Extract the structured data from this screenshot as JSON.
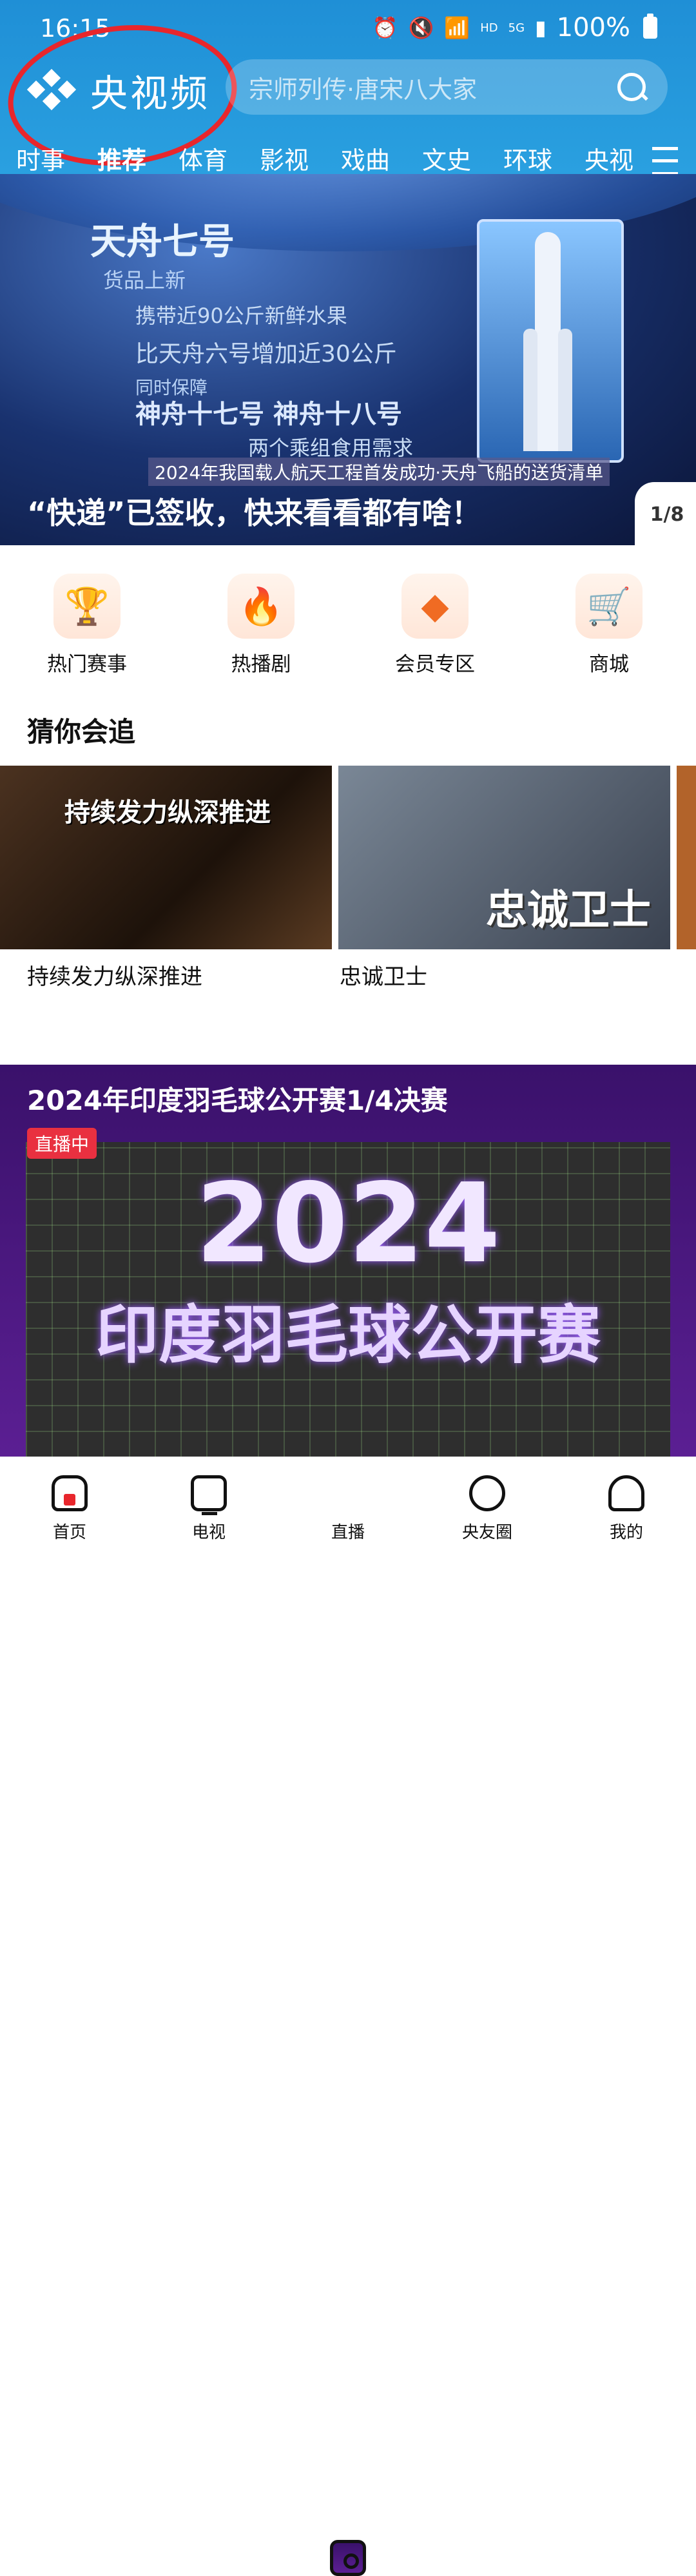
{
  "status_bar": {
    "time": "16:15",
    "battery": "100%",
    "net1": "HD",
    "net2": "5G"
  },
  "header": {
    "app_name": "央视频",
    "search_placeholder": "宗师列传·唐宋八大家"
  },
  "tabs": [
    "时事",
    "推荐",
    "体育",
    "影视",
    "戏曲",
    "文史",
    "环球",
    "央视"
  ],
  "hero": {
    "overlay_title": "天舟七号",
    "overlay_subtitle": "货品上新",
    "overlay_line1": "携带近90公斤新鲜水果",
    "overlay_line2": "比天舟六号增加近30公斤",
    "overlay_line3": "同时保障",
    "overlay_line4": "神舟十七号  神舟十八号",
    "overlay_line5": "两个乘组食用需求",
    "caption": "2024年我国载人航天工程首发成功·天舟飞船的送货清单",
    "title": "“快递”已签收，快来看看都有啥！",
    "page_indicator": "1/8"
  },
  "quick_links": [
    {
      "label": "热门赛事",
      "icon": "trophy-icon"
    },
    {
      "label": "热播剧",
      "icon": "hot-flame-icon"
    },
    {
      "label": "会员专区",
      "icon": "vip-icon"
    },
    {
      "label": "商城",
      "icon": "shopping-cart-icon"
    }
  ],
  "section": {
    "title": "猜你会追"
  },
  "cards": [
    {
      "title": "持续发力纵深推进",
      "image_text": "持续发力纵深推进"
    },
    {
      "title": "忠诚卫士",
      "image_text": "忠诚卫士"
    },
    {
      "title": "《"
    }
  ],
  "live": {
    "title": "2024年印度羽毛球公开赛1/4决赛",
    "badge": "直播中",
    "year": "2024",
    "name": "印度羽毛球公开赛"
  },
  "bottom_nav": [
    {
      "label": "首页",
      "icon": "home-icon"
    },
    {
      "label": "电视",
      "icon": "tv-icon"
    },
    {
      "label": "直播",
      "icon": "live-icon"
    },
    {
      "label": "央友圈",
      "icon": "circle-icon"
    },
    {
      "label": "我的",
      "icon": "profile-icon"
    }
  ]
}
